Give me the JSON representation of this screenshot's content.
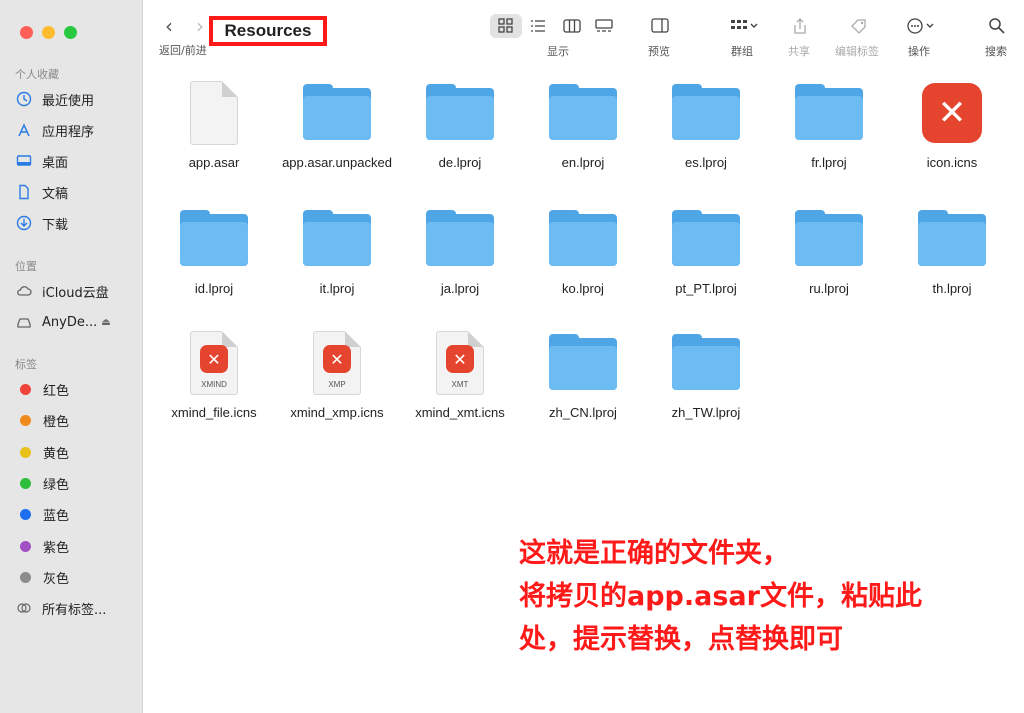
{
  "window": {
    "title": "Resources"
  },
  "toolbar": {
    "nav_label": "返回/前进",
    "view_label": "显示",
    "preview_label": "预览",
    "group_label": "群组",
    "share_label": "共享",
    "tags_label": "编辑标签",
    "action_label": "操作",
    "search_label": "搜索"
  },
  "sidebar": {
    "favorites_title": "个人收藏",
    "favorites": [
      {
        "label": "最近使用",
        "icon": "clock-icon"
      },
      {
        "label": "应用程序",
        "icon": "apps-icon"
      },
      {
        "label": "桌面",
        "icon": "desktop-icon"
      },
      {
        "label": "文稿",
        "icon": "document-icon"
      },
      {
        "label": "下载",
        "icon": "download-icon"
      }
    ],
    "locations_title": "位置",
    "locations": [
      {
        "label": "iCloud云盘",
        "icon": "cloud-icon"
      },
      {
        "label": "AnyDe...",
        "icon": "drive-icon"
      }
    ],
    "tags_title": "标签",
    "tags": [
      {
        "label": "红色",
        "color": "#f0443a"
      },
      {
        "label": "橙色",
        "color": "#f08a1c"
      },
      {
        "label": "黄色",
        "color": "#e8c21a"
      },
      {
        "label": "绿色",
        "color": "#2fbd3c"
      },
      {
        "label": "蓝色",
        "color": "#1e6ff0"
      },
      {
        "label": "紫色",
        "color": "#a34fc4"
      },
      {
        "label": "灰色",
        "color": "#8c8c8c"
      }
    ],
    "all_tags": "所有标签..."
  },
  "files": [
    {
      "name": "app.asar",
      "kind": "document"
    },
    {
      "name": "app.asar.unpacked",
      "kind": "folder"
    },
    {
      "name": "de.lproj",
      "kind": "folder"
    },
    {
      "name": "en.lproj",
      "kind": "folder"
    },
    {
      "name": "es.lproj",
      "kind": "folder"
    },
    {
      "name": "fr.lproj",
      "kind": "folder"
    },
    {
      "name": "icon.icns",
      "kind": "app-icon"
    },
    {
      "name": "id.lproj",
      "kind": "folder"
    },
    {
      "name": "it.lproj",
      "kind": "folder"
    },
    {
      "name": "ja.lproj",
      "kind": "folder"
    },
    {
      "name": "ko.lproj",
      "kind": "folder"
    },
    {
      "name": "pt_PT.lproj",
      "kind": "folder"
    },
    {
      "name": "ru.lproj",
      "kind": "folder"
    },
    {
      "name": "th.lproj",
      "kind": "folder"
    },
    {
      "name": "xmind_file.icns",
      "kind": "icns-doc",
      "badge": "XMIND"
    },
    {
      "name": "xmind_xmp.icns",
      "kind": "icns-doc",
      "badge": "XMP"
    },
    {
      "name": "xmind_xmt.icns",
      "kind": "icns-doc",
      "badge": "XMT"
    },
    {
      "name": "zh_CN.lproj",
      "kind": "folder"
    },
    {
      "name": "zh_TW.lproj",
      "kind": "folder"
    }
  ],
  "annotation": {
    "line1": "这就是正确的文件夹，",
    "line2": "将拷贝的app.asar文件，粘贴此",
    "line3": "处，提示替换，点替换即可",
    "color": "#ff1a1a"
  }
}
